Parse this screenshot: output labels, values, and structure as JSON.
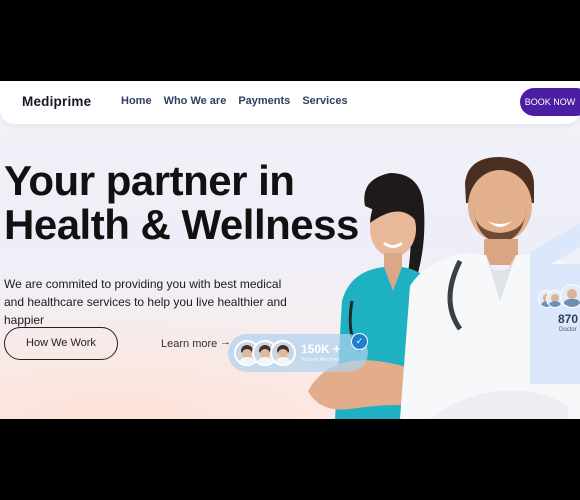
{
  "brand": "Mediprime",
  "nav": {
    "items": [
      "Home",
      "Who We are",
      "Payments",
      "Services"
    ],
    "cta": "BOOK NOW"
  },
  "hero": {
    "title_line1": "Your partner in",
    "title_line2": "Health & Wellness",
    "subtitle": "We are commited to providing you with best medical and healthcare services to help you live healthier and happier",
    "primary_button": "How We Work",
    "secondary_link": "Learn more",
    "arrow": "→"
  },
  "stats": {
    "patients_count": "150K +",
    "patients_label": "Patient Recover",
    "doctors_count": "870",
    "doctors_label": "Doctor"
  },
  "colors": {
    "accent": "#4b1ea3",
    "nav_text": "#2f3f63",
    "badge_blue": "#1d7fce",
    "scrub_teal": "#1eb1c4"
  },
  "icons": [
    "check-icon",
    "arrow-right-icon"
  ]
}
